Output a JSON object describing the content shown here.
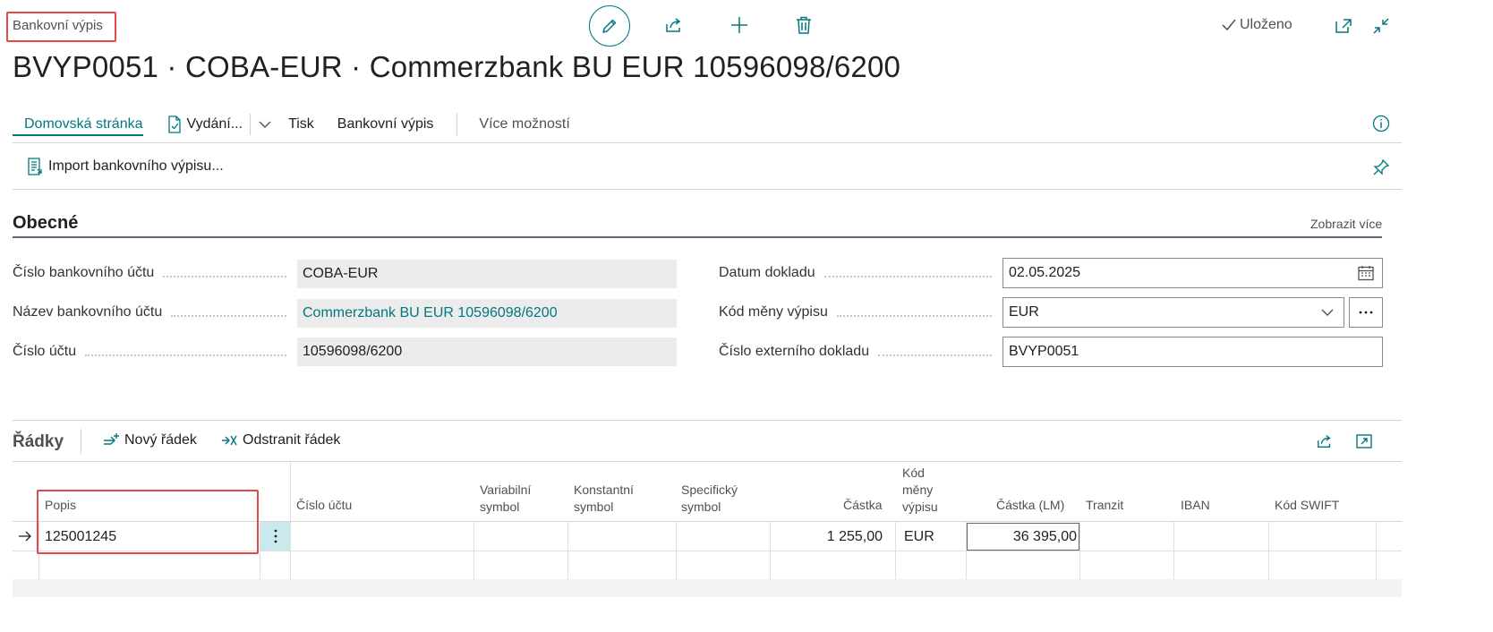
{
  "header": {
    "caption": "Bankovní výpis",
    "title": "BVYP0051 · COBA-EUR · Commerzbank BU EUR 10596098/6200",
    "saved_status": "Uloženo"
  },
  "actions": {
    "home": "Domovská stránka",
    "issue": "Vydání...",
    "print": "Tisk",
    "bank_statement": "Bankovní výpis",
    "more": "Více možností"
  },
  "promoted": {
    "import": "Import bankovního výpisu..."
  },
  "general": {
    "title": "Obecné",
    "show_more": "Zobrazit více",
    "left_fields": [
      {
        "label": "Číslo bankovního účtu",
        "value": "COBA-EUR"
      },
      {
        "label": "Název bankovního účtu",
        "value": "Commerzbank BU EUR 10596098/6200"
      },
      {
        "label": "Číslo účtu",
        "value": "10596098/6200"
      }
    ],
    "right_fields": [
      {
        "label": "Datum dokladu",
        "value": "02.05.2025"
      },
      {
        "label": "Kód měny výpisu",
        "value": "EUR"
      },
      {
        "label": "Číslo externího dokladu",
        "value": "BVYP0051"
      }
    ]
  },
  "lines": {
    "title": "Řádky",
    "new_line": "Nový řádek",
    "delete_line": "Odstranit řádek",
    "columns": {
      "popis": "Popis",
      "cislo_uctu": "Číslo účtu",
      "var_1": "Variabilní",
      "var_2": "symbol",
      "konst_1": "Konstantní",
      "konst_2": "symbol",
      "spec_1": "Specifický",
      "spec_2": "symbol",
      "castka": "Částka",
      "kod_1": "Kód",
      "kod_2": "měny",
      "kod_3": "výpisu",
      "castka_lm": "Částka (LM)",
      "tranzit": "Tranzit",
      "iban": "IBAN",
      "swift": "Kód SWIFT"
    },
    "row": {
      "popis": "125001245",
      "castka": "1 255,00",
      "mena": "EUR",
      "castka_lm": "36 395,00"
    }
  }
}
